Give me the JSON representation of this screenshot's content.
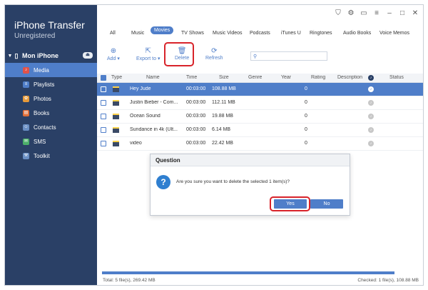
{
  "app": {
    "title": "iPhone Transfer",
    "subtitle": "Unregistered"
  },
  "device": {
    "name": "Mon iPhone"
  },
  "nav": [
    {
      "label": "Media",
      "icon": "media-icon",
      "color": "#e0524a"
    },
    {
      "label": "Playlists",
      "icon": "playlists-icon",
      "color": "#4f7ec9"
    },
    {
      "label": "Photos",
      "icon": "photos-icon",
      "color": "#e69a3a"
    },
    {
      "label": "Books",
      "icon": "books-icon",
      "color": "#e06f3a"
    },
    {
      "label": "Contacts",
      "icon": "contacts-icon",
      "color": "#6a8fc4"
    },
    {
      "label": "SMS",
      "icon": "sms-icon",
      "color": "#4caf6a"
    },
    {
      "label": "Toolkit",
      "icon": "toolkit-icon",
      "color": "#6a8fc4"
    }
  ],
  "tabs": [
    "All",
    "Music",
    "Movies",
    "TV Shows",
    "Music Videos",
    "Podcasts",
    "iTunes U",
    "Ringtones",
    "Audio Books",
    "Voice Memos"
  ],
  "active_tab": "Movies",
  "toolbar": {
    "add": "Add",
    "export": "Export to",
    "delete": "Delete",
    "refresh": "Refresh"
  },
  "search": {
    "placeholder": ""
  },
  "table": {
    "headers": {
      "type": "Type",
      "name": "Name",
      "time": "Time",
      "size": "Size",
      "genre": "Genre",
      "year": "Year",
      "rating": "Rating",
      "description": "Description",
      "status": "Status"
    },
    "rows": [
      {
        "name": "Hey Jude",
        "time": "00:03:00",
        "size": "108.88 MB",
        "rating": "0",
        "selected": true
      },
      {
        "name": "Justin Bieber - Com...",
        "time": "00:03:00",
        "size": "112.11 MB",
        "rating": "0",
        "selected": false
      },
      {
        "name": "Ocean Sound",
        "time": "00:03:00",
        "size": "19.88 MB",
        "rating": "0",
        "selected": false
      },
      {
        "name": "Sundance in 4k (Ult...",
        "time": "00:03:00",
        "size": "6.14 MB",
        "rating": "0",
        "selected": false
      },
      {
        "name": "video",
        "time": "00:03:00",
        "size": "22.42 MB",
        "rating": "0",
        "selected": false
      }
    ]
  },
  "dialog": {
    "title": "Question",
    "message": "Are you sure you want to delete the selected 1 item(s)?",
    "yes": "Yes",
    "no": "No"
  },
  "footer": {
    "total": "Total: 5 file(s), 269.42 MB",
    "checked": "Checked: 1 file(s), 108.88 MB"
  },
  "colors": {
    "sidebar": "#2a4066",
    "accent": "#4f7ec9",
    "highlight": "#d8232a"
  }
}
